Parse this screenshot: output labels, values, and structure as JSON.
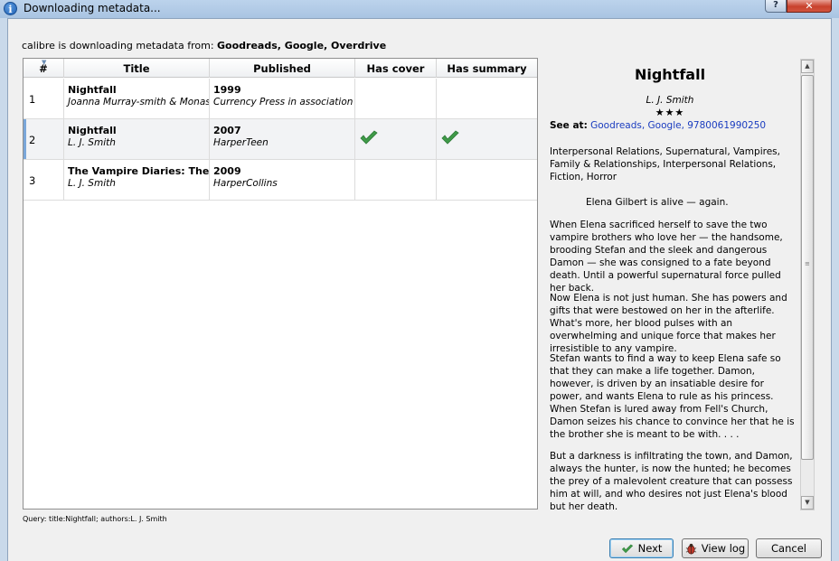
{
  "window": {
    "title": "Downloading metadata...",
    "help_label": "?",
    "close_label": "✕"
  },
  "source": {
    "prefix": "calibre is downloading metadata from: ",
    "sources": "Goodreads, Google, Overdrive"
  },
  "table": {
    "columns": [
      "#",
      "Title",
      "Published",
      "Has cover",
      "Has summary"
    ],
    "rows": [
      {
        "num": "1",
        "title": "Nightfall",
        "author": "Joanna Murray-smith & Monash University",
        "year": "1999",
        "publisher": "Currency Press in association with",
        "has_cover": false,
        "has_summary": false
      },
      {
        "num": "2",
        "title": "Nightfall",
        "author": "L. J. Smith",
        "year": "2007",
        "publisher": "HarperTeen",
        "has_cover": true,
        "has_summary": true
      },
      {
        "num": "3",
        "title": "The Vampire Diaries: The Return",
        "author": "L. J. Smith",
        "year": "2009",
        "publisher": "HarperCollins",
        "has_cover": false,
        "has_summary": false
      }
    ]
  },
  "details": {
    "title": "Nightfall",
    "author": "L. J. Smith",
    "stars": "★★★",
    "see_at_label": "See at:",
    "see_at_links": "Goodreads, Google, 9780061990250",
    "tags": "Interpersonal Relations, Supernatural, Vampires, Family & Relationships, Interpersonal Relations, Fiction, Horror",
    "paragraphs": [
      "Elena Gilbert is alive — again.",
      "When Elena sacrificed herself to save the two vampire brothers who love her — the handsome, brooding Stefan and the sleek and dangerous Damon — she was consigned to a fate beyond death. Until a powerful supernatural force pulled her back.",
      "Now Elena is not just human. She has powers and gifts that were bestowed on her in the afterlife. What's more, her blood pulses with an overwhelming and unique force that makes her irresistible to any vampire.",
      "Stefan wants to find a way to keep Elena safe so that they can make a life together. Damon, however, is driven by an insatiable desire for power, and wants Elena to rule as his princess. When Stefan is lured away from Fell's Church, Damon seizes his chance to convince her that he is the brother she is meant to be with. . . .",
      "But a darkness is infiltrating the town, and Damon, always the hunter, is now the hunted; he becomes the prey of a malevolent creature that can possess him at will, and who desires not just Elena's blood but her death."
    ]
  },
  "footer": {
    "query": "Query: title:Nightfall; authors:L. J. Smith",
    "next_label": "Next",
    "log_label": "View log",
    "cancel_label": "Cancel"
  },
  "colors": {
    "link": "#1a3cbf",
    "check": "#3f9a48",
    "selection_marker": "#7aa7d9"
  }
}
